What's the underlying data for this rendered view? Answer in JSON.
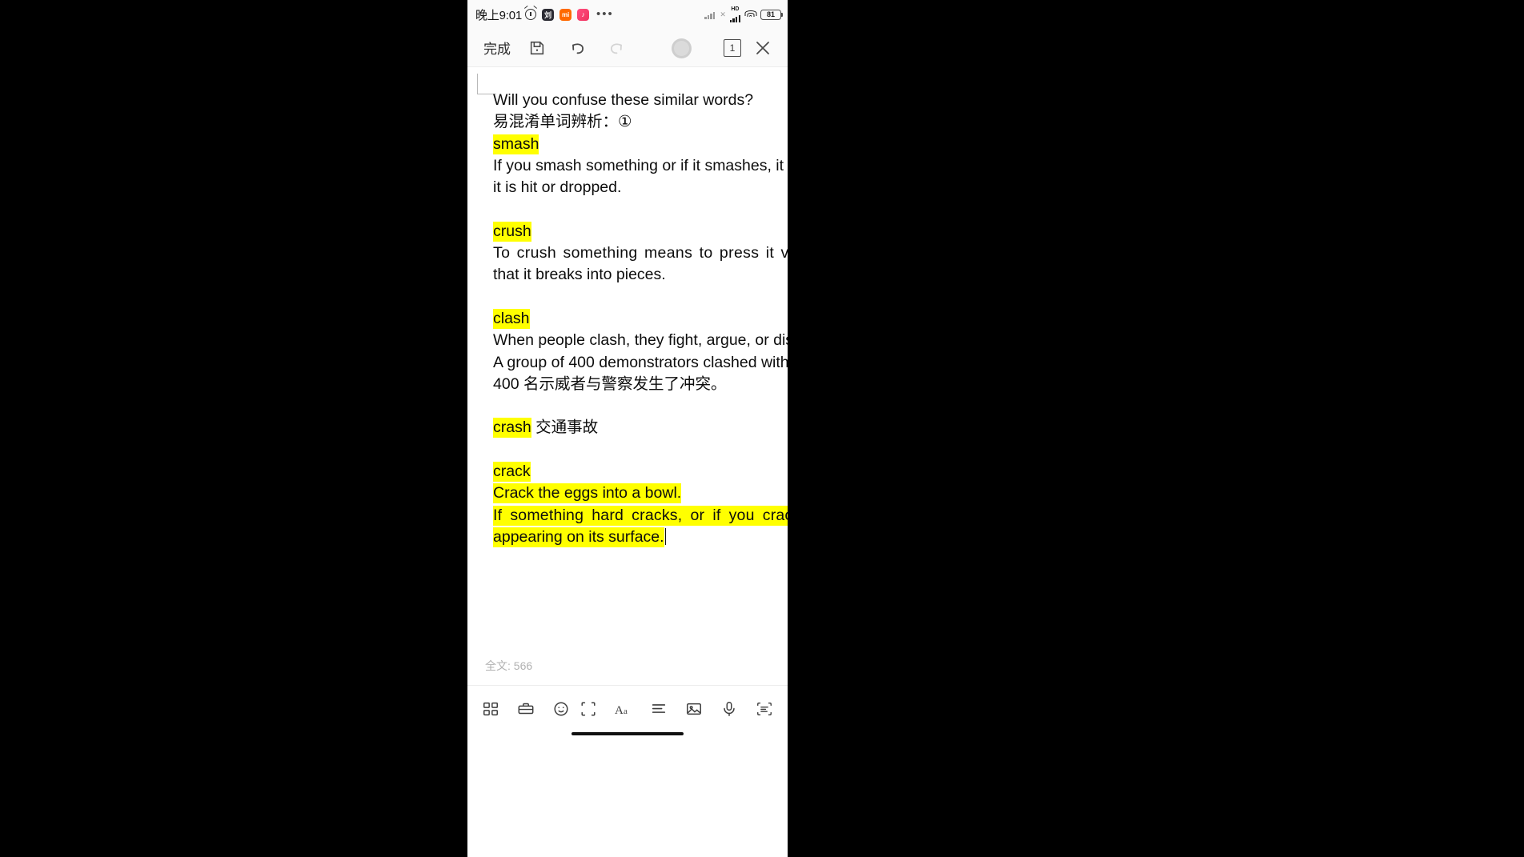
{
  "statusbar": {
    "time": "晚上9:01",
    "alarm_icon": "alarm-clock-icon",
    "app_badge_1": "刘",
    "app_badge_2": "mi",
    "overflow": "•••",
    "hd_label": "HD",
    "signal_x": "✕",
    "battery_level": "81"
  },
  "toolbar": {
    "done_label": "完成",
    "save_icon": "floppy-disk-icon",
    "undo_icon": "undo-arrow-icon",
    "redo_icon": "redo-arrow-icon",
    "page_count": "1",
    "close_icon": "close-x-icon"
  },
  "document": {
    "lines": [
      {
        "id": "l1",
        "text": "Will you confuse these similar words?",
        "highlight": "none"
      },
      {
        "id": "l2",
        "text": "易混淆单词辨析：①",
        "highlight": "none"
      },
      {
        "id": "l3",
        "text": "smash",
        "highlight": "word"
      },
      {
        "id": "l4",
        "text": "If you smash something or if it smashes, it b",
        "highlight": "none"
      },
      {
        "id": "l5",
        "text": "it is hit or dropped.",
        "highlight": "none"
      },
      {
        "id": "l6",
        "text": "",
        "highlight": "none"
      },
      {
        "id": "l7",
        "text": "crush",
        "highlight": "word"
      },
      {
        "id": "l8",
        "text": "To crush something means to press it very",
        "highlight": "none"
      },
      {
        "id": "l9",
        "text": "that it breaks into pieces.",
        "highlight": "none"
      },
      {
        "id": "l10",
        "text": "",
        "highlight": "none"
      },
      {
        "id": "l11",
        "text": "clash",
        "highlight": "word"
      },
      {
        "id": "l12",
        "text": "When people clash, they fight, argue, or dis",
        "highlight": "none"
      },
      {
        "id": "l13",
        "text": "A group of 400 demonstrators clashed with",
        "highlight": "none"
      },
      {
        "id": "l14",
        "text": "400 名示威者与警察发生了冲突。",
        "highlight": "none"
      },
      {
        "id": "l15",
        "text": "",
        "highlight": "none"
      },
      {
        "id": "l16",
        "text": "crash 交通事故",
        "highlight": "partial"
      },
      {
        "id": "l17",
        "text": "",
        "highlight": "none"
      },
      {
        "id": "l18",
        "text": "crack",
        "highlight": "word"
      },
      {
        "id": "l19",
        "text": "Crack the eggs into a bowl.",
        "highlight": "full"
      },
      {
        "id": "l20",
        "text": "If something hard cracks, or if you crack it",
        "highlight": "full"
      },
      {
        "id": "l21",
        "text": "appearing on its surface.",
        "highlight": "full"
      }
    ],
    "l3_word": "smash",
    "l7_word": "crush",
    "l11_word": "clash",
    "l16_word": "crash",
    "l16_rest": " 交通事故",
    "l18_word": "crack",
    "word_count_label": "全文: 566"
  },
  "bottombar": {
    "icons": [
      {
        "name": "grid-blocks-icon"
      },
      {
        "name": "toolbox-icon"
      },
      {
        "name": "emoji-smiley-icon"
      },
      {
        "name": "page-frame-icon"
      },
      {
        "name": "font-format-icon"
      },
      {
        "name": "align-list-icon"
      },
      {
        "name": "image-icon"
      },
      {
        "name": "microphone-icon"
      },
      {
        "name": "scan-text-icon"
      }
    ]
  },
  "colors": {
    "highlight": "#ffff00",
    "text": "#0d0d0d",
    "chrome_bg": "#fafafa",
    "page_bg": "#ffffff",
    "muted": "#b1b1b1"
  }
}
